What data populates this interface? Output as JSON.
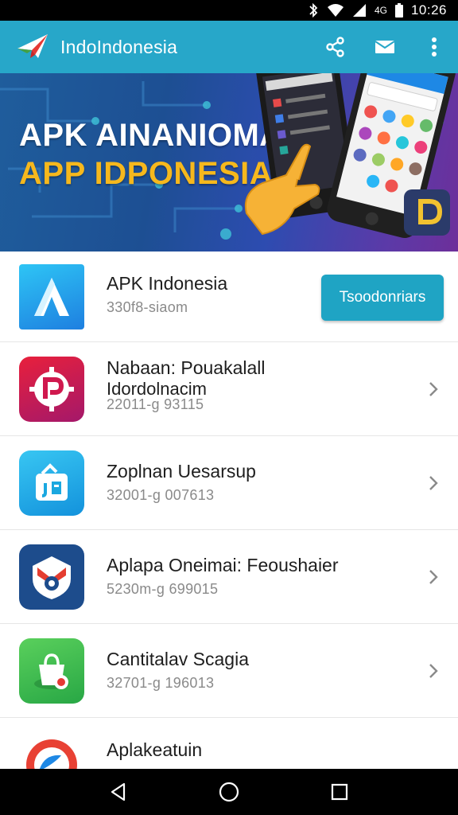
{
  "status_bar": {
    "time": "10:26",
    "icons": [
      "bluetooth-icon",
      "wifi-icon",
      "signal-icon",
      "4g-icon",
      "battery-icon"
    ],
    "network_label": "4G"
  },
  "app_bar": {
    "title": "IndoIndonesia",
    "logo": "paper-plane-logo",
    "actions": [
      "share-icon",
      "email-icon",
      "more-vert-icon"
    ],
    "color": "#27a7c9"
  },
  "banner": {
    "line1": "APK AINANIOMA",
    "line2": "APP IDPONESIA",
    "line1_color": "#ffffff",
    "line2_color": "#f6b81d"
  },
  "featured": {
    "name": "APK Indonesia",
    "meta": "330f8-siaom",
    "button_label": "Tsoodonriars",
    "button_color": "#1fa4c4"
  },
  "apps": [
    {
      "name": "Nabaan: Pouakalall",
      "name_line2": "Idordolnacim",
      "meta": "22011-g 93115",
      "icon": "p-badge-icon",
      "color": "#c8174c"
    },
    {
      "name": "Zoplnan Uesarsup",
      "meta": "32001-g 007613",
      "icon": "bag-lock-icon",
      "color": "#1aa8e0"
    },
    {
      "name": "Aplapa  Oneimai: Feoushaier",
      "meta": "5230m-g 699015",
      "icon": "mail-shield-icon",
      "color": "#1d4c8c"
    },
    {
      "name": "Cantitalav Scagia",
      "meta": "32701-g 196013",
      "icon": "bag-tag-icon",
      "color": "#44c149"
    },
    {
      "name": "Aplakeatuin",
      "meta": "",
      "icon": "circle-ball-icon",
      "color": "#e84134"
    }
  ],
  "nav": [
    "back-icon",
    "home-icon",
    "recents-icon"
  ]
}
